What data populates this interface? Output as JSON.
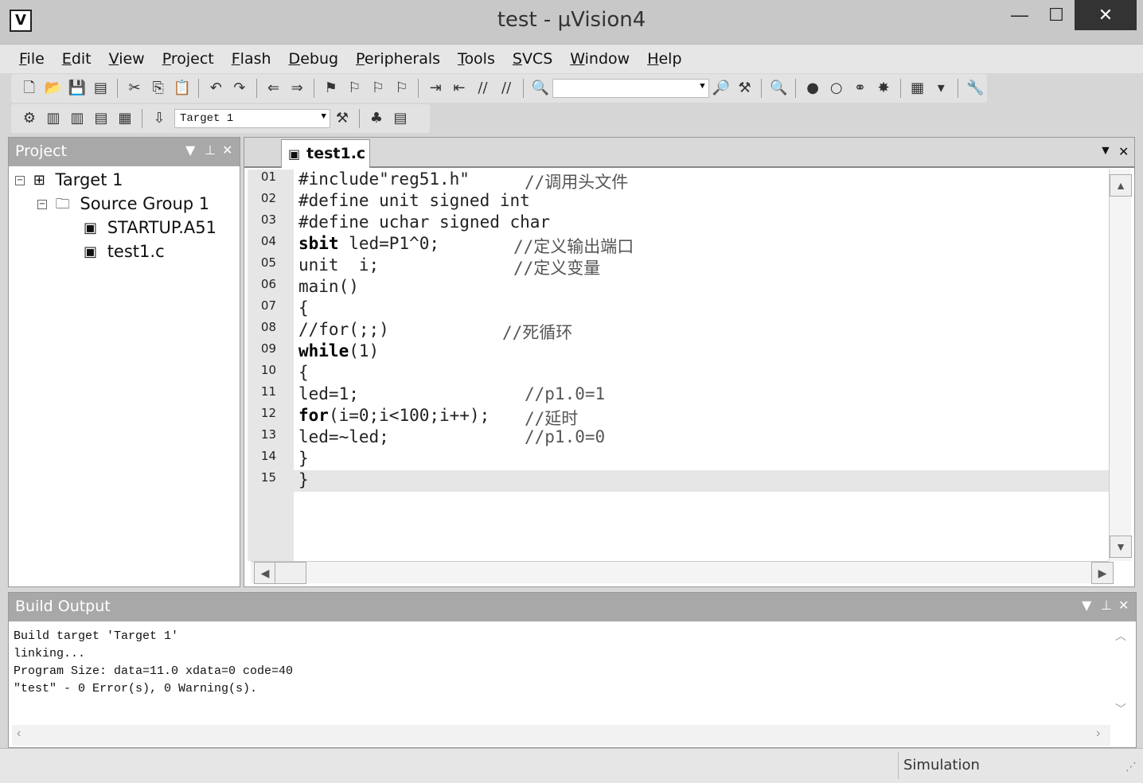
{
  "window": {
    "title": "test  - µVision4",
    "app_icon": "µVision-icon"
  },
  "menu": [
    "File",
    "Edit",
    "View",
    "Project",
    "Flash",
    "Debug",
    "Peripherals",
    "Tools",
    "SVCS",
    "Window",
    "Help"
  ],
  "toolbar2": {
    "target_combo": "Target 1"
  },
  "project_panel": {
    "title": "Project",
    "tree": [
      {
        "label": "Target 1",
        "level": 0,
        "toggle": "−",
        "icon": "target-icon"
      },
      {
        "label": "Source Group 1",
        "level": 1,
        "toggle": "−",
        "icon": "folder-icon"
      },
      {
        "label": "STARTUP.A51",
        "level": 2,
        "icon": "file-icon"
      },
      {
        "label": "test1.c",
        "level": 2,
        "icon": "file-icon"
      }
    ]
  },
  "editor": {
    "tab_label": "test1.c",
    "lines": [
      {
        "num": "01",
        "code": "#include\"reg51.h\"",
        "comment": "//调用头文件"
      },
      {
        "num": "02",
        "code": "#define unit signed int",
        "comment": ""
      },
      {
        "num": "03",
        "code": "#define uchar signed char",
        "comment": ""
      },
      {
        "num": "04",
        "kw": "sbit",
        "code": " led=P1^0;",
        "comment": "//定义输出端口"
      },
      {
        "num": "05",
        "code": "unit  i;",
        "comment": "//定义变量"
      },
      {
        "num": "06",
        "code": "main()",
        "comment": ""
      },
      {
        "num": "07",
        "code": "{",
        "comment": ""
      },
      {
        "num": "08",
        "code": "//for(;;)",
        "comment": "//死循环"
      },
      {
        "num": "09",
        "kw": "while",
        "code": "(1)",
        "comment": ""
      },
      {
        "num": "10",
        "code": "{",
        "comment": ""
      },
      {
        "num": "11",
        "code": "led=1;",
        "comment": "//p1.0=1"
      },
      {
        "num": "12",
        "kw": "for",
        "code": "(i=0;i<100;i++);",
        "comment": "//延时"
      },
      {
        "num": "13",
        "code": "led=~led;",
        "comment": "//p1.0=0"
      },
      {
        "num": "14",
        "code": "}",
        "comment": ""
      },
      {
        "num": "15",
        "code": "}",
        "comment": ""
      }
    ]
  },
  "build_output": {
    "title": "Build Output",
    "lines": [
      "Build target 'Target 1'",
      "linking...",
      "Program Size: data=11.0 xdata=0 code=40",
      "\"test\" - 0 Error(s), 0 Warning(s)."
    ]
  },
  "statusbar": {
    "mode": "Simulation"
  }
}
